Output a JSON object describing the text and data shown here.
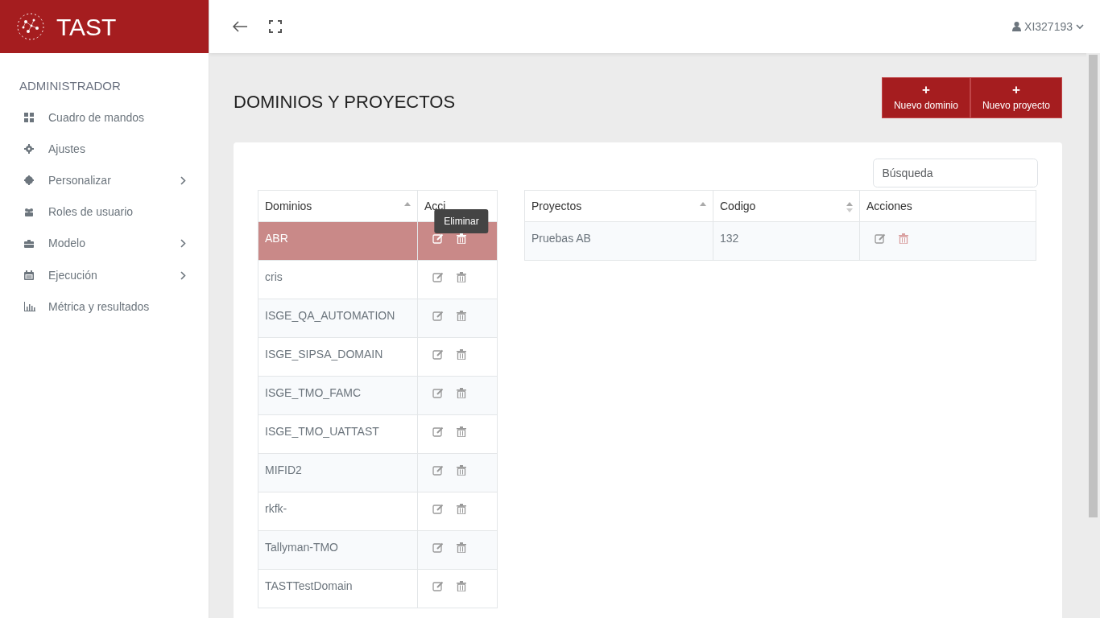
{
  "brand": {
    "title": "TAST"
  },
  "user": {
    "name": "XI327193"
  },
  "sidebar": {
    "heading": "ADMINISTRADOR",
    "items": [
      {
        "label": "Cuadro de mandos",
        "has_submenu": false
      },
      {
        "label": "Ajustes",
        "has_submenu": false
      },
      {
        "label": "Personalizar",
        "has_submenu": true
      },
      {
        "label": "Roles de usuario",
        "has_submenu": false
      },
      {
        "label": "Modelo",
        "has_submenu": true
      },
      {
        "label": "Ejecución",
        "has_submenu": true
      },
      {
        "label": "Métrica y resultados",
        "has_submenu": false
      }
    ]
  },
  "page": {
    "title": "DOMINIOS Y PROYECTOS"
  },
  "buttons": [
    {
      "label": "Nuevo dominio",
      "icon": "+"
    },
    {
      "label": "Nuevo proyecto",
      "icon": "+"
    }
  ],
  "search": {
    "placeholder": "Búsqueda"
  },
  "domains_table": {
    "columns": [
      "Dominios",
      "Acci"
    ],
    "tooltip": "Eliminar",
    "rows": [
      {
        "name": "ABR",
        "selected": true
      },
      {
        "name": "cris",
        "selected": false
      },
      {
        "name": "ISGE_QA_AUTOMATION",
        "selected": false
      },
      {
        "name": "ISGE_SIPSA_DOMAIN",
        "selected": false
      },
      {
        "name": "ISGE_TMO_FAMC",
        "selected": false
      },
      {
        "name": "ISGE_TMO_UATTAST",
        "selected": false
      },
      {
        "name": "MIFID2",
        "selected": false
      },
      {
        "name": "rkfk-",
        "selected": false
      },
      {
        "name": "Tallyman-TMO",
        "selected": false
      },
      {
        "name": "TASTTestDomain",
        "selected": false
      }
    ]
  },
  "projects_table": {
    "columns": [
      "Proyectos",
      "Codigo",
      "Acciones"
    ],
    "rows": [
      {
        "name": "Pruebas AB",
        "code": "132"
      }
    ]
  }
}
